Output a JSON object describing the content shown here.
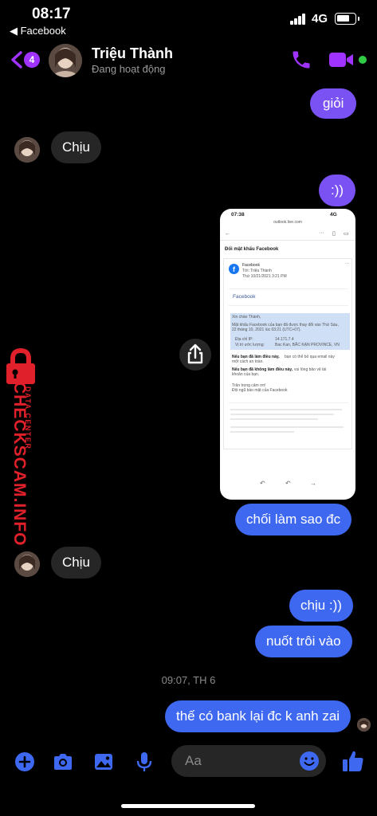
{
  "status_bar": {
    "time": "08:17",
    "back_app": "◀ Facebook",
    "network": "4G"
  },
  "header": {
    "unread_count": "4",
    "contact_name": "Triệu Thành",
    "contact_status": "Đang hoạt động",
    "accent_color": "#a033ff",
    "online_color": "#31cc46"
  },
  "messages": [
    {
      "direction": "out",
      "text": "giỏi"
    },
    {
      "direction": "in",
      "text": "Chịu"
    },
    {
      "direction": "out",
      "text": ":))"
    },
    {
      "direction": "out",
      "type": "image"
    },
    {
      "direction": "out",
      "text": "chối làm sao đc"
    },
    {
      "direction": "in",
      "text": "Chịu"
    },
    {
      "direction": "out",
      "text": "chịu :))"
    },
    {
      "direction": "out",
      "text": "nuốt trôi vào"
    },
    {
      "direction": "out",
      "text": "thế có bank lại đc k anh zai"
    }
  ],
  "timestamp": "09:07, TH 6",
  "screenshot": {
    "time": "07:38",
    "network": "4G",
    "url": "outlook.live.com",
    "subject": "Đổi mật khẩu Facebook",
    "sender": "Facebook",
    "to_line": "Tới: Triệu Thành",
    "date_line": "Thứ 10/21/2021 3:21 PM",
    "brand": "Facebook",
    "greeting": "Xin chào Thành,",
    "line1": "Mật khẩu Facebook của bạn đã được thay đổi vào Thứ Sáu,",
    "line2": "22 tháng 10, 2021 lúc 03:21 (UTC+07).",
    "ip_label": "Địa chỉ IP:",
    "ip_value": "14.171.7.4",
    "loc_label": "Vị trí ước lượng:",
    "loc_value": "Bac Kan, BẮC KẠN PROVINCE, VN",
    "note1_bold": "Nếu bạn đã làm điều này,",
    "note1_rest": "bạn có thể bỏ qua email này",
    "note1_tail": "một cách an toàn.",
    "note2_bold": "Nếu bạn đã không làm điều này,",
    "note2_rest": "vui lòng bảo vệ tài",
    "note2_tail": "khoản của bạn.",
    "signoff1": "Trân trọng cảm ơn!",
    "signoff2": "Đội ngũ bảo mật của Facebook"
  },
  "watermark": {
    "brand": "CHECKSCAM.INFO",
    "sub": "DATA CENTER",
    "color": "#e0202a"
  },
  "composer": {
    "placeholder": "Aa"
  },
  "colors": {
    "outgoing_purple": "#7a52f4",
    "outgoing_blue": "#3e68f0",
    "incoming": "#262626"
  }
}
